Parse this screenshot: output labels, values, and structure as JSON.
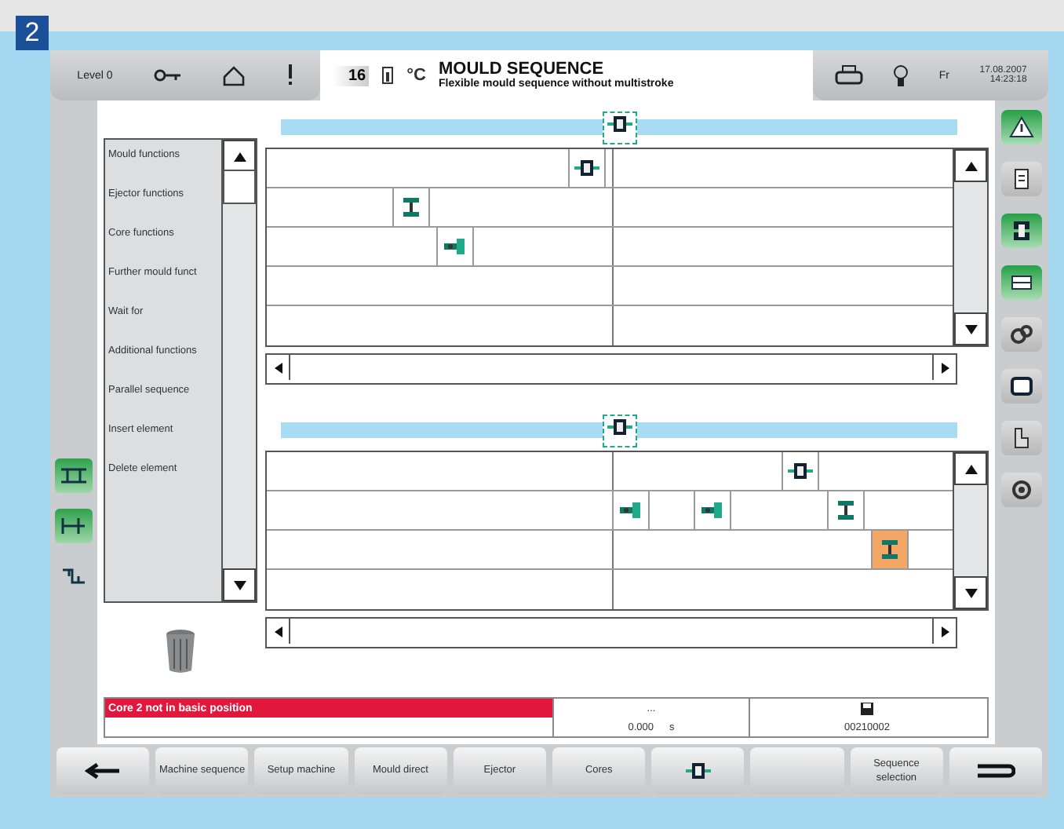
{
  "figure_badge": "2",
  "header": {
    "level": "Level 0",
    "mould_number": "16",
    "unit": "°C",
    "title": "MOULD SEQUENCE",
    "subtitle": "Flexible mould sequence without multistroke",
    "day": "Fr",
    "date": "17.08.2007",
    "time": "14:23:18"
  },
  "left_tools": [
    {
      "kind": "parallel",
      "selected": true
    },
    {
      "kind": "branch",
      "selected": true
    },
    {
      "kind": "link",
      "selected": false
    }
  ],
  "function_list": [
    "Mould functions",
    "Ejector functions",
    "Core functions",
    "Further mould funct",
    "Wait for",
    "Additional functions",
    "Parallel sequence",
    "Insert element",
    "Delete element"
  ],
  "sequences": [
    {
      "rows": [
        {
          "elements": [
            {
              "kind": "mould",
              "selected": false
            }
          ]
        },
        {
          "elements": [
            {
              "kind": "ejector",
              "selected": false
            }
          ]
        },
        {
          "elements": [
            {
              "kind": "core",
              "selected": false
            }
          ]
        },
        {
          "elements": []
        },
        {
          "elements": []
        }
      ]
    },
    {
      "rows": [
        {
          "elements": [
            {
              "kind": "mould",
              "selected": false
            }
          ]
        },
        {
          "elements": [
            {
              "kind": "core",
              "selected": false
            },
            {
              "kind": "core",
              "selected": false
            },
            {
              "kind": "ejector",
              "selected": false
            }
          ]
        },
        {
          "elements": [
            {
              "kind": "ejector",
              "selected": true
            }
          ]
        },
        {
          "elements": []
        }
      ]
    }
  ],
  "status": {
    "message": "Core 2 not in basic position",
    "field_1": "...",
    "value": "0.000",
    "unit": "s",
    "code": "00210002"
  },
  "side_tabs": [
    {
      "kind": "warning",
      "selected": true
    },
    {
      "kind": "document",
      "selected": false
    },
    {
      "kind": "mould",
      "selected": true
    },
    {
      "kind": "overview",
      "selected": true
    },
    {
      "kind": "gears",
      "selected": false
    },
    {
      "kind": "monitor",
      "selected": false
    },
    {
      "kind": "puzzle",
      "selected": false
    },
    {
      "kind": "cycle",
      "selected": false
    }
  ],
  "bottom_buttons": [
    {
      "kind": "back"
    },
    {
      "kind": "text",
      "label": "Machine sequence"
    },
    {
      "kind": "text",
      "label": "Setup machine"
    },
    {
      "kind": "text",
      "label": "Mould direct"
    },
    {
      "kind": "text",
      "label": "Ejector"
    },
    {
      "kind": "text",
      "label": "Cores"
    },
    {
      "kind": "mould"
    },
    {
      "kind": "empty"
    },
    {
      "kind": "text",
      "label": "Sequence selection"
    },
    {
      "kind": "return"
    }
  ]
}
